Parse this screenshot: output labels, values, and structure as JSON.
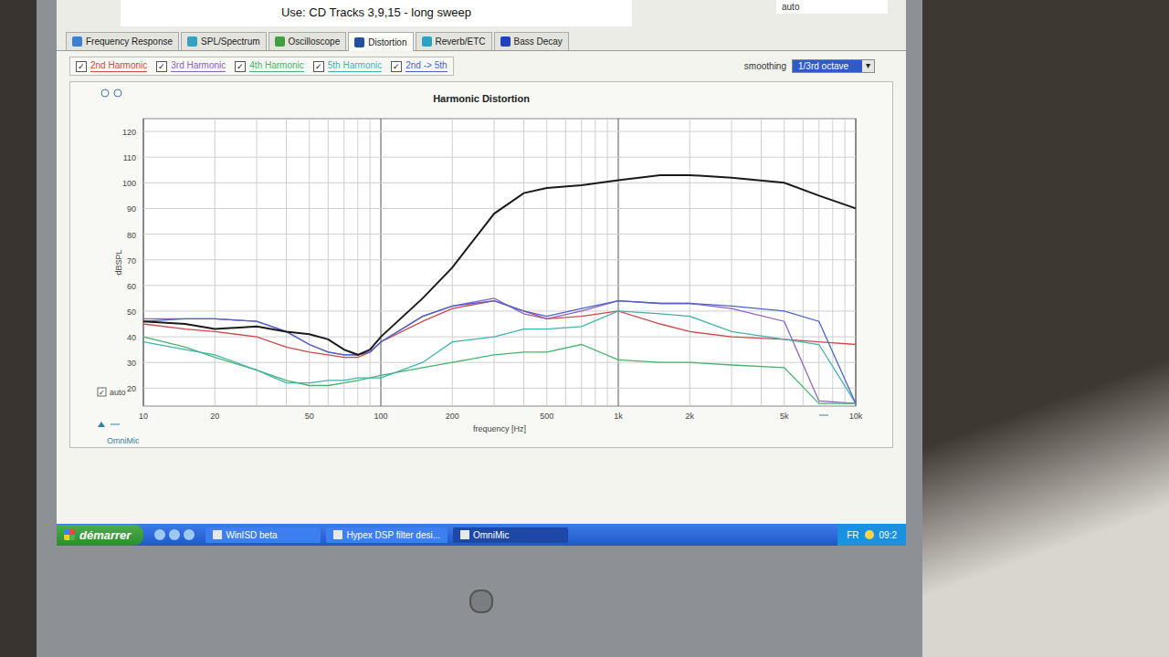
{
  "header": {
    "instruction": "Use: CD Tracks 3,9,15 - long sweep",
    "mode": "auto"
  },
  "tabs": [
    {
      "label": "Frequency Response",
      "selected": false
    },
    {
      "label": "SPL/Spectrum",
      "selected": false
    },
    {
      "label": "Oscilloscope",
      "selected": false
    },
    {
      "label": "Distortion",
      "selected": true
    },
    {
      "label": "Reverb/ETC",
      "selected": false
    },
    {
      "label": "Bass Decay",
      "selected": false
    }
  ],
  "smoothing": {
    "label": "smoothing",
    "value": "1/3rd octave"
  },
  "chart": {
    "title": "Harmonic Distortion",
    "y_label": "dBSPL",
    "x_label": "frequency [Hz]",
    "y_ticks": [
      "120",
      "110",
      "100",
      "90",
      "80",
      "70",
      "60",
      "50",
      "40",
      "30",
      "20"
    ],
    "x_ticks": [
      "10",
      "20",
      "50",
      "100",
      "200",
      "500",
      "1k",
      "2k",
      "5k",
      "10k"
    ],
    "auto": {
      "label": "auto",
      "checked": true
    },
    "frequencies": [
      10,
      15,
      20,
      30,
      40,
      50,
      60,
      70,
      80,
      90,
      100,
      150,
      200,
      300,
      400,
      500,
      700,
      1000,
      1500,
      2000,
      3000,
      5000,
      7000,
      10000
    ],
    "fundamental": {
      "color": "#1a1a1a",
      "values": [
        46,
        45,
        43,
        44,
        42,
        41,
        39,
        35,
        33,
        35,
        40,
        55,
        67,
        88,
        96,
        98,
        99,
        101,
        103,
        103,
        102,
        100,
        95,
        90
      ]
    },
    "series": [
      {
        "label": "2nd Harmonic",
        "checked": true,
        "color": "#d04848",
        "values": [
          45,
          43,
          42,
          40,
          36,
          34,
          33,
          32,
          32,
          34,
          38,
          46,
          51,
          54,
          50,
          47,
          48,
          50,
          45,
          42,
          40,
          39,
          38,
          37
        ]
      },
      {
        "label": "3rd Harmonic",
        "checked": true,
        "color": "#8a62c4",
        "values": [
          47,
          47,
          47,
          46,
          42,
          37,
          34,
          33,
          33,
          34,
          38,
          48,
          52,
          55,
          49,
          47,
          50,
          54,
          53,
          53,
          51,
          46,
          15,
          14
        ]
      },
      {
        "label": "4th Harmonic",
        "checked": true,
        "color": "#46b46a",
        "values": [
          40,
          36,
          32,
          27,
          23,
          21,
          21,
          22,
          23,
          24,
          25,
          28,
          30,
          33,
          34,
          34,
          37,
          31,
          30,
          30,
          29,
          28,
          14,
          14
        ]
      },
      {
        "label": "5th Harmonic",
        "checked": true,
        "color": "#3fb3b0",
        "values": [
          38,
          35,
          33,
          27,
          22,
          22,
          23,
          23,
          24,
          24,
          24,
          30,
          38,
          40,
          43,
          43,
          44,
          50,
          49,
          48,
          42,
          39,
          37,
          14
        ]
      },
      {
        "label": "2nd -> 5th",
        "checked": true,
        "color": "#4a62cc",
        "values": [
          46,
          47,
          47,
          46,
          42,
          37,
          34,
          33,
          33,
          34,
          38,
          48,
          52,
          54,
          50,
          48,
          51,
          54,
          53,
          53,
          52,
          50,
          46,
          14
        ]
      }
    ]
  },
  "footer": {
    "brand": "OmniMic"
  },
  "taskbar": {
    "start": "démarrer",
    "items": [
      {
        "label": "WinISD beta",
        "selected": false
      },
      {
        "label": "Hypex DSP filter desi...",
        "selected": false
      },
      {
        "label": "OmniMic",
        "selected": true
      }
    ],
    "lang": "FR",
    "clock": "09:2"
  }
}
